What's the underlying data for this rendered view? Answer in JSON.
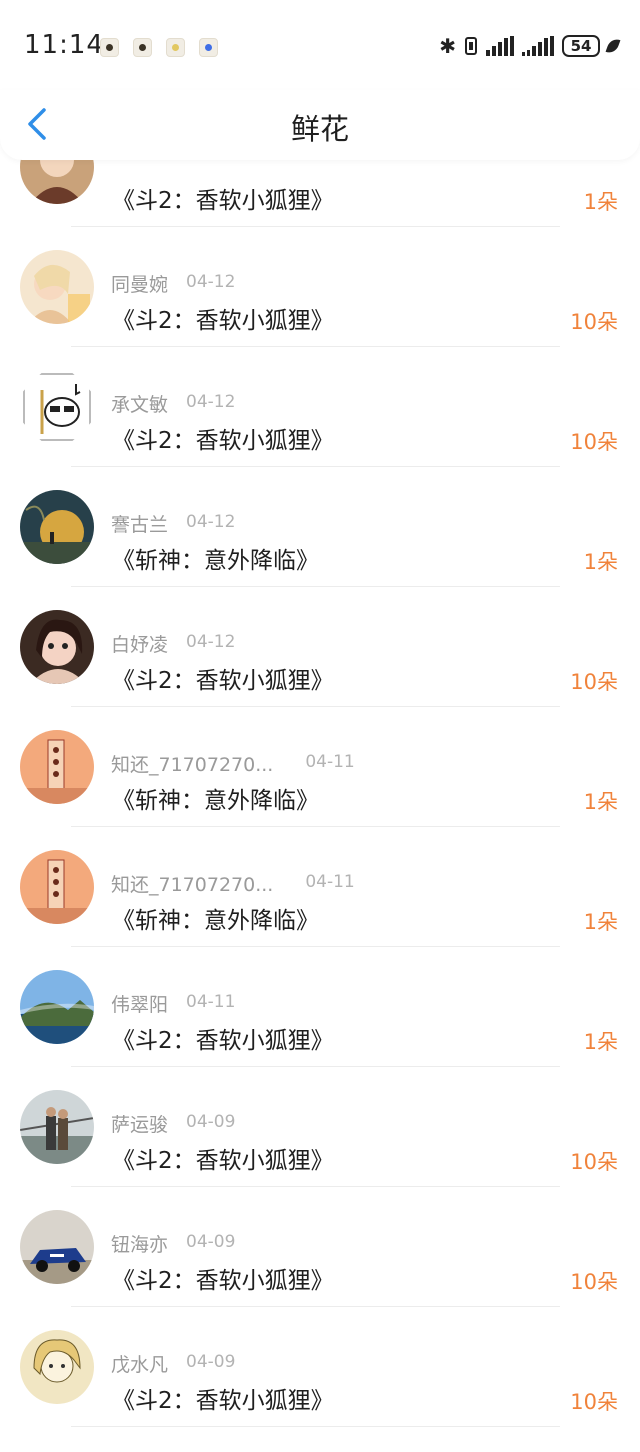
{
  "status_bar": {
    "time": "11:14",
    "battery": "54",
    "notification_icons": [
      "app-icon-1",
      "app-icon-2",
      "app-icon-3",
      "app-icon-4"
    ],
    "status_icons": [
      "bluetooth-icon",
      "vibrate-icon",
      "signal-icon",
      "signal-icon",
      "battery-icon",
      "leaf-icon"
    ]
  },
  "nav": {
    "title": "鲜花",
    "back_icon": "chevron-left-icon"
  },
  "colors": {
    "accent_orange": "#f0833b",
    "back_blue": "#2f8ee8",
    "secondary_text": "#9a9a9a"
  },
  "rows": [
    {
      "username": "",
      "date": "",
      "book": "《斗2：香软小狐狸》",
      "count": "1朵"
    },
    {
      "username": "同曼婉",
      "date": "04-12",
      "book": "《斗2：香软小狐狸》",
      "count": "10朵"
    },
    {
      "username": "承文敏",
      "date": "04-12",
      "book": "《斗2：香软小狐狸》",
      "count": "10朵"
    },
    {
      "username": "謇古兰",
      "date": "04-12",
      "book": "《斩神：意外降临》",
      "count": "1朵"
    },
    {
      "username": "白妤凌",
      "date": "04-12",
      "book": "《斗2：香软小狐狸》",
      "count": "10朵"
    },
    {
      "username": "知还_71707270...",
      "date": "04-11",
      "book": "《斩神：意外降临》",
      "count": "1朵"
    },
    {
      "username": "知还_71707270...",
      "date": "04-11",
      "book": "《斩神：意外降临》",
      "count": "1朵"
    },
    {
      "username": "伟翠阳",
      "date": "04-11",
      "book": "《斗2：香软小狐狸》",
      "count": "1朵"
    },
    {
      "username": "萨运骏",
      "date": "04-09",
      "book": "《斗2：香软小狐狸》",
      "count": "10朵"
    },
    {
      "username": "钮海亦",
      "date": "04-09",
      "book": "《斗2：香软小狐狸》",
      "count": "10朵"
    },
    {
      "username": "戊水凡",
      "date": "04-09",
      "book": "《斗2：香软小狐狸》",
      "count": "10朵"
    }
  ]
}
